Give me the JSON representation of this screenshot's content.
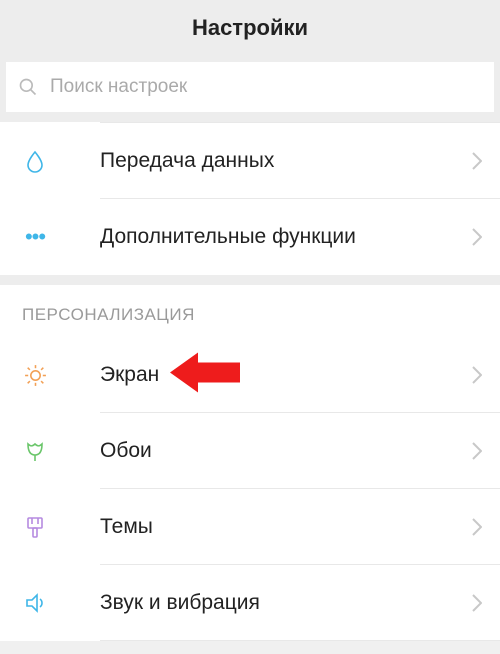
{
  "header": {
    "title": "Настройки"
  },
  "search": {
    "placeholder": "Поиск настроек"
  },
  "group1": {
    "items": [
      {
        "label": "Передача данных",
        "iconName": "droplet-icon",
        "iconColor": "#3fb6e8"
      },
      {
        "label": "Дополнительные функции",
        "iconName": "dots-icon",
        "iconColor": "#3fb6e8"
      }
    ]
  },
  "group2": {
    "header": "ПЕРСОНАЛИЗАЦИЯ",
    "items": [
      {
        "label": "Экран",
        "iconName": "sun-icon",
        "iconColor": "#f2a055",
        "highlight": true
      },
      {
        "label": "Обои",
        "iconName": "tulip-icon",
        "iconColor": "#6bc66b"
      },
      {
        "label": "Темы",
        "iconName": "brush-icon",
        "iconColor": "#b58ae0"
      },
      {
        "label": "Звук и вибрация",
        "iconName": "sound-icon",
        "iconColor": "#3fb6e8"
      }
    ]
  },
  "annotation": {
    "color": "#ee1c1c"
  }
}
